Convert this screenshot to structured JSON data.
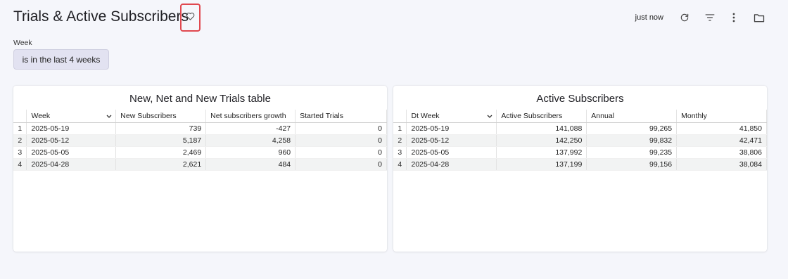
{
  "header": {
    "title": "Trials & Active Subscribers",
    "updated": "just now"
  },
  "filter": {
    "label": "Week",
    "chip": "is in the last 4 weeks"
  },
  "left_table": {
    "title": "New, Net and New Trials table",
    "columns": [
      "Week",
      "New Subscribers",
      "Net subscribers growth",
      "Started Trials"
    ],
    "rows": [
      {
        "idx": "1",
        "c1": "2025-05-19",
        "c2": "739",
        "c3": "-427",
        "c4": "0"
      },
      {
        "idx": "2",
        "c1": "2025-05-12",
        "c2": "5,187",
        "c3": "4,258",
        "c4": "0"
      },
      {
        "idx": "3",
        "c1": "2025-05-05",
        "c2": "2,469",
        "c3": "960",
        "c4": "0"
      },
      {
        "idx": "4",
        "c1": "2025-04-28",
        "c2": "2,621",
        "c3": "484",
        "c4": "0"
      }
    ]
  },
  "right_table": {
    "title": "Active Subscribers",
    "columns": [
      "Dt Week",
      "Active Subscribers",
      "Annual",
      "Monthly"
    ],
    "rows": [
      {
        "idx": "1",
        "c1": "2025-05-19",
        "c2": "141,088",
        "c3": "99,265",
        "c4": "41,850"
      },
      {
        "idx": "2",
        "c1": "2025-05-12",
        "c2": "142,250",
        "c3": "99,832",
        "c4": "42,471"
      },
      {
        "idx": "3",
        "c1": "2025-05-05",
        "c2": "137,992",
        "c3": "99,235",
        "c4": "38,806"
      },
      {
        "idx": "4",
        "c1": "2025-04-28",
        "c2": "137,199",
        "c3": "99,156",
        "c4": "38,084"
      }
    ]
  },
  "icons": {
    "favorite": "heart-icon",
    "refresh": "refresh-icon",
    "filter": "filter-icon",
    "more": "more-vertical-icon",
    "folder": "folder-icon",
    "sort": "chevron-down-icon"
  },
  "colors": {
    "highlight_border": "#e0484f",
    "chip_bg": "#e2e2f1",
    "page_bg": "#f5f6fb"
  }
}
